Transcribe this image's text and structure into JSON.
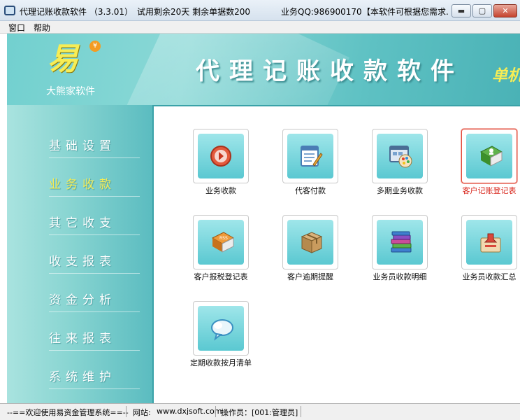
{
  "window": {
    "title": "代理记账收款软件 （3.3.01）",
    "trial": "试用剩余20天   剩余单据数200",
    "qq": "业务QQ:986900170",
    "notice": "【本软件可根据您需求...",
    "min_label": "▬",
    "max_label": "▢",
    "close_label": "✕"
  },
  "menu": [
    "窗口",
    "帮助"
  ],
  "banner": {
    "brand": "大熊家软件",
    "title": "代理记账收款软件",
    "subtitle": "单机",
    "logo_glyph": "易",
    "coin": "¥"
  },
  "sidebar": {
    "items": [
      {
        "label": "基础设置",
        "active": false
      },
      {
        "label": "业务收款",
        "active": true
      },
      {
        "label": "其它收支",
        "active": false
      },
      {
        "label": "收支报表",
        "active": false
      },
      {
        "label": "资金分析",
        "active": false
      },
      {
        "label": "往来报表",
        "active": false
      },
      {
        "label": "系统维护",
        "active": false
      }
    ]
  },
  "tiles": [
    {
      "label": "业务收款",
      "icon": "red-arrow-circle-icon"
    },
    {
      "label": "代客付款",
      "icon": "notepad-pen-icon"
    },
    {
      "label": "多期业务收款",
      "icon": "palette-window-icon"
    },
    {
      "label": "客户记账登记表",
      "icon": "green-book-user-icon",
      "selected": true
    },
    {
      "label": "客户报税登记表",
      "icon": "rss-book-icon"
    },
    {
      "label": "客户逾期提醒",
      "icon": "package-box-icon"
    },
    {
      "label": "业务员收款明细",
      "icon": "book-stack-icon"
    },
    {
      "label": "业务员收款汇总",
      "icon": "stamp-box-icon"
    },
    {
      "label": "定期收款按月清单",
      "icon": "cloud-chat-icon"
    }
  ],
  "status": {
    "welcome": "--==欢迎使用易资金管理系统==--",
    "site_label": "网站:",
    "site": "www.dxjsoft.com",
    "operator": "操作员：[001:管理员]"
  },
  "colors": {
    "accent": "#5ec1c3",
    "active_nav": "#f7ed55",
    "selected_border": "#e34a3a"
  }
}
